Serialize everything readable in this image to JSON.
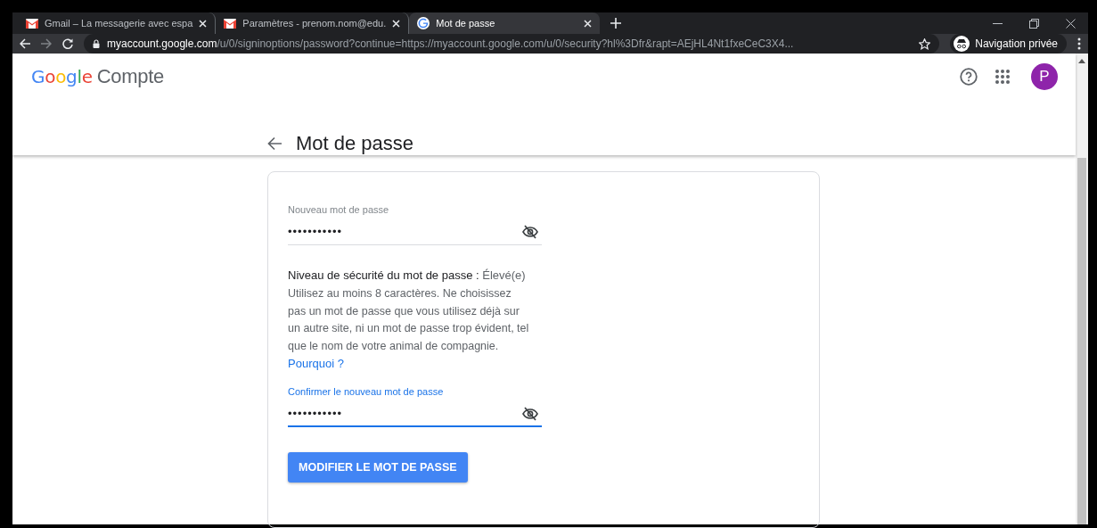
{
  "tabs": [
    {
      "title": "Gmail – La messagerie avec espa",
      "kind": "gmail",
      "selected": false
    },
    {
      "title": "Paramètres - prenom.nom@edu.",
      "kind": "gmail",
      "selected": false
    },
    {
      "title": "Mot de passe",
      "kind": "google",
      "selected": true
    }
  ],
  "address_bar": {
    "domain": "myaccount.google.com",
    "path": "/u/0/signinoptions/password?continue=https://myaccount.google.com/u/0/security?hl%3Dfr&rapt=AEjHL4Nt1fxeCeC3X4..."
  },
  "incognito": {
    "label": "Navigation privée"
  },
  "header": {
    "logo": "Google",
    "product": "Compte",
    "avatar_letter": "P",
    "page_title": "Mot de passe"
  },
  "form": {
    "fields": [
      {
        "label": "Nouveau mot de passe",
        "value": "•••••••••••",
        "focused": false
      },
      {
        "label": "Confirmer le nouveau mot de passe",
        "value": "•••••••••••",
        "focused": true
      }
    ],
    "strength": {
      "label": "Niveau de sécurité du mot de passe :",
      "value": "Élevé(e)"
    },
    "hint": "Utilisez au moins 8 caractères. Ne choisissez pas un mot de passe que vous utilisez déjà sur un autre site, ni un mot de passe trop évident, tel que le nom de votre animal de compagnie.",
    "link": "Pourquoi ?",
    "submit": "MODIFIER LE MOT DE PASSE"
  }
}
